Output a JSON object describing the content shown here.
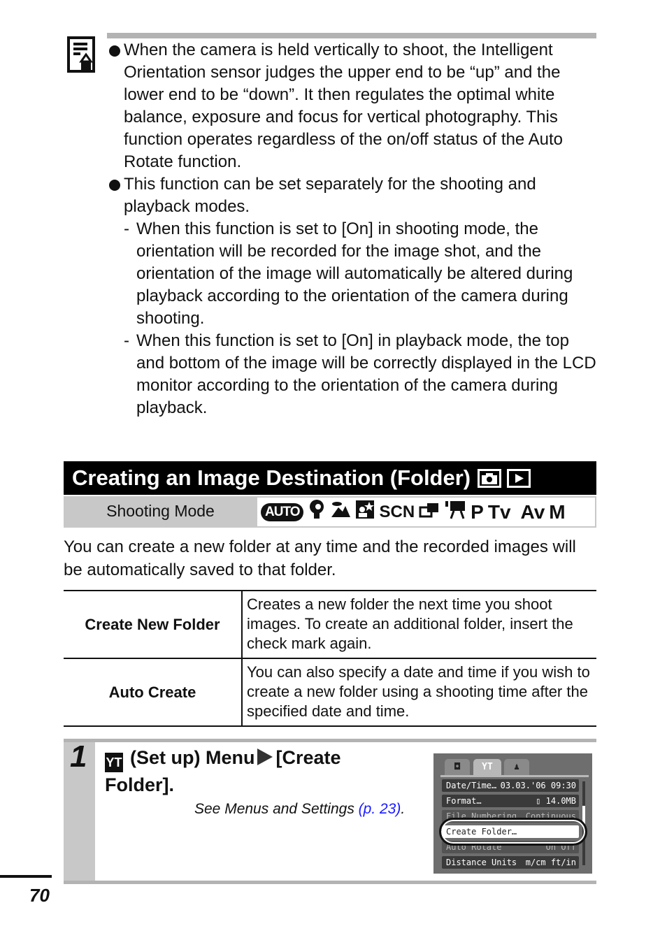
{
  "note": {
    "icon": "memo-pencil-icon",
    "bullets": [
      {
        "text": "When the camera is held vertically to shoot, the Intelligent Orientation sensor judges the upper end to be “up” and the lower end to be “down”. It then regulates the optimal white balance, exposure and focus for vertical photography. This function operates regardless of the on/off status of the Auto Rotate function."
      },
      {
        "text": "This function can be set separately for the shooting and playback modes.",
        "subitems": [
          "When this function is set to [On] in shooting mode, the orientation will be recorded for the image shot, and the orientation of the image will automatically be altered during playback according to the orientation of the camera during shooting.",
          "When this function is set to [On] in playback mode, the top and bottom of the image will be correctly displayed in the LCD monitor according to the orientation of the camera during playback."
        ]
      }
    ]
  },
  "section": {
    "title": "Creating an Image Destination (Folder)",
    "title_icons": [
      "camera-icon",
      "playback-icon"
    ],
    "shooting_mode_label": "Shooting Mode",
    "modes": [
      "AUTO",
      "portrait",
      "landscape",
      "night-snapshot",
      "SCN",
      "stitch-assist",
      "movie",
      "P",
      "Tv",
      "Av",
      "M"
    ],
    "mode_text": {
      "auto": "AUTO",
      "scn": "SCN",
      "p": "P",
      "tv": "Tv",
      "av": "Av",
      "m": "M"
    },
    "intro": "You can create a new folder at any time and the recorded images will be automatically saved to that folder."
  },
  "table": {
    "rows": [
      {
        "key": "Create New Folder",
        "value": "Creates a new folder the next time you shoot images. To create an additional folder, insert the check mark again."
      },
      {
        "key": "Auto Create",
        "value": "You can also specify a date and time if you wish to create a new folder using a shooting time after the specified date and time."
      }
    ]
  },
  "step": {
    "number": "1",
    "title_part1": "(Set up) Menu",
    "title_part2": "[Create Folder].",
    "setup_icon_glyph": "YT",
    "see_text": "See Menus and Settings ",
    "see_link": "(p. 23)",
    "see_end": "."
  },
  "camera_screen": {
    "tabs": [
      "camera",
      "set-up",
      "my-camera"
    ],
    "tab_glyphs": [
      "◘",
      "ΥΤ",
      "♟"
    ],
    "rows": [
      {
        "label": "Date/Time…",
        "value": "03.03.'06 09:30"
      },
      {
        "label": "Format…",
        "value": "14.0MB"
      },
      {
        "label": "File Numbering",
        "value": "Continuous"
      },
      {
        "label": "Create Folder…",
        "value": ""
      },
      {
        "label": "Auto Rotate",
        "value": "On Off"
      },
      {
        "label": "Distance Units",
        "value": "m/cm ft/in"
      }
    ]
  },
  "page_number": "70"
}
